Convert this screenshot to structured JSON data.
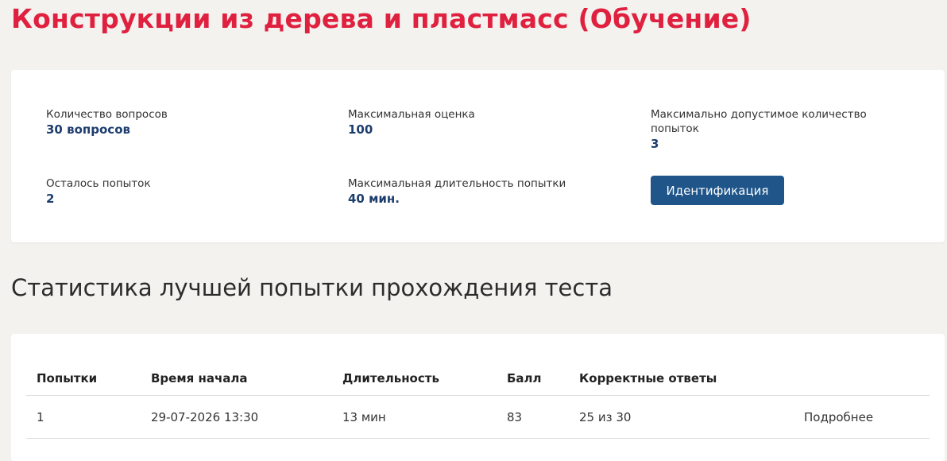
{
  "page": {
    "title": "Конструкции из дерева и пластмасс (Обучение)"
  },
  "info": {
    "question_count": {
      "label": "Количество вопросов",
      "value": "30 вопросов"
    },
    "max_score": {
      "label": "Максимальная оценка",
      "value": "100"
    },
    "max_attempts": {
      "label": "Максимально допустимое количество попыток",
      "value": "3"
    },
    "attempts_left": {
      "label": "Осталось попыток",
      "value": "2"
    },
    "max_duration": {
      "label": "Максимальная длительность попытки",
      "value": "40 мин."
    },
    "identify_button": "Идентификация"
  },
  "stats": {
    "title": "Статистика лучшей попытки прохождения теста",
    "columns": [
      "Попытки",
      "Время начала",
      "Длительность",
      "Балл",
      "Корректные ответы"
    ],
    "rows": [
      {
        "attempt": "1",
        "start_time": "29-07-2026 13:30",
        "duration": "13 мин",
        "score": "83",
        "correct": "25 из 30",
        "details": "Подробнее"
      }
    ]
  },
  "colors": {
    "title_accent": "#e0203f",
    "value_text": "#1d3d6e",
    "button": "#1f5589",
    "background": "#f3f2ef"
  }
}
